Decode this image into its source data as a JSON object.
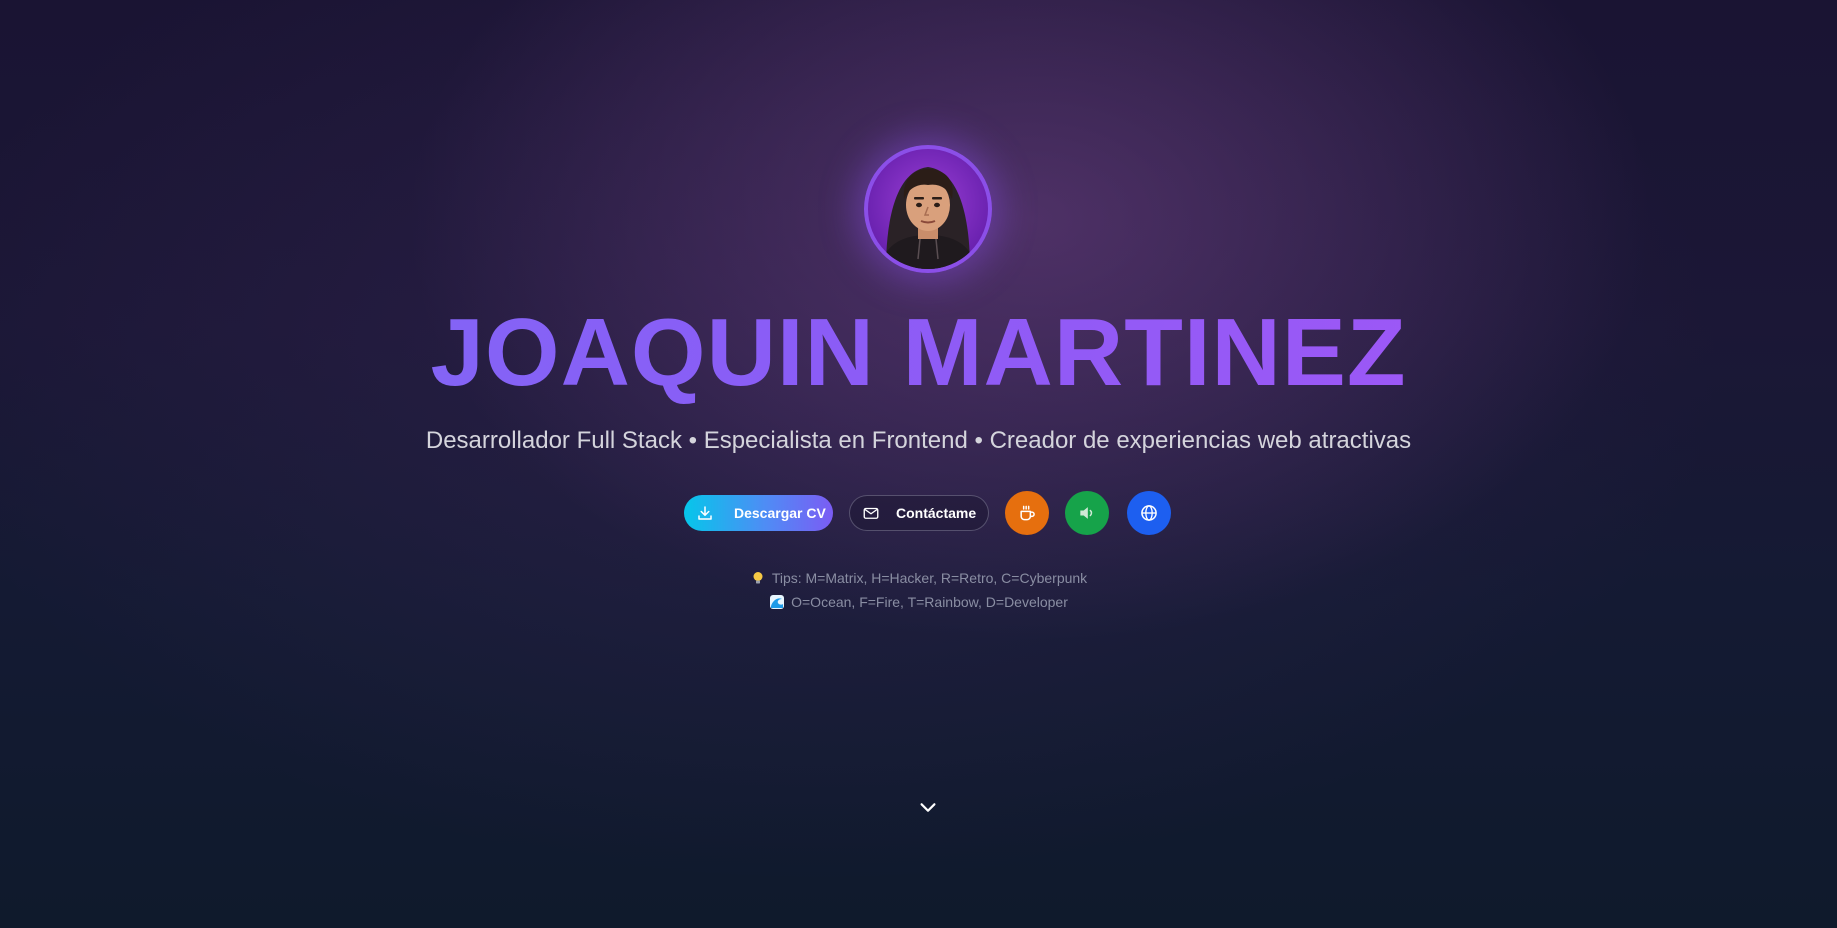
{
  "hero": {
    "name": "JOAQUIN MARTINEZ",
    "tagline": "Desarrollador Full Stack • Especialista en Frontend • Creador de experiencias web atractivas",
    "avatar_icon": "avatar-portrait"
  },
  "actions": {
    "download_cv_label": "Descargar CV",
    "download_icon": "download-icon",
    "contact_label": "Contáctame",
    "contact_icon": "mail-icon",
    "round_buttons": [
      {
        "icon": "coffee-icon",
        "color": "#e66f0e"
      },
      {
        "icon": "sound-icon",
        "color": "#16a34a"
      },
      {
        "icon": "globe-icon",
        "color": "#1d5ff0"
      }
    ]
  },
  "tips": {
    "line1": "Tips: M=Matrix, H=Hacker, R=Retro, C=Cyberpunk",
    "line1_icon": "lightbulb-icon",
    "line2": "O=Ocean, F=Fire, T=Rainbow, D=Developer",
    "line2_icon": "wave-icon"
  },
  "scroll_icon": "chevron-down-icon",
  "colors": {
    "accent_purple": "#8b5cf6",
    "cv_gradient_start": "#06c6ea",
    "cv_gradient_end": "#7b5cf4"
  }
}
